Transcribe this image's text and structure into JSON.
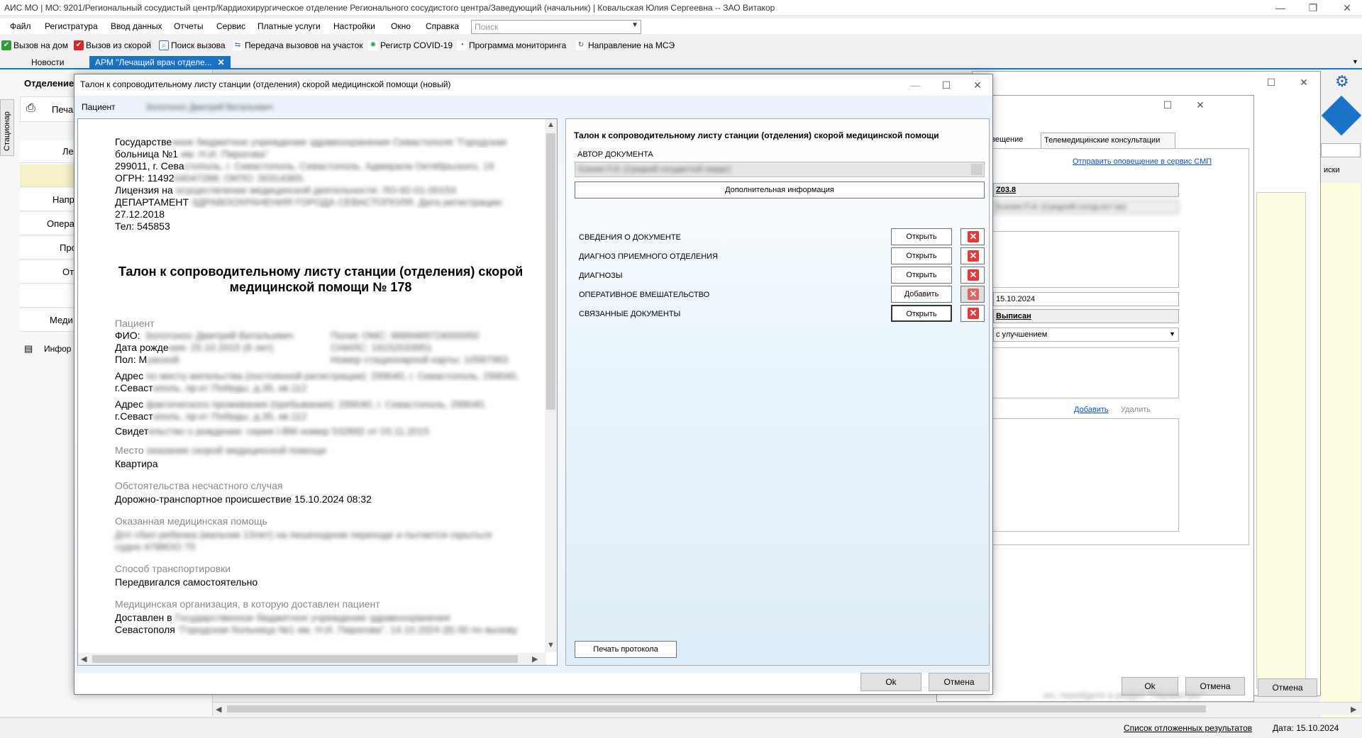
{
  "app": {
    "title": "АИС МО | МО: 9201/Региональный сосудистый центр/Кардиохирургическое отделение Регионального сосудистого центра/Заведующий (начальник) | Ковальская Юлия Сергеевна -- ЗАО Витакор"
  },
  "menu": {
    "items": [
      "Файл",
      "Регистратура",
      "Ввод данных",
      "Отчеты",
      "Сервис",
      "Платные услуги",
      "Настройки",
      "Окно",
      "Справка"
    ],
    "search_placeholder": "Поиск"
  },
  "toolbar": {
    "items": [
      {
        "label": "Вызов на дом",
        "icon": "house-call-icon",
        "color": "#2e9e3a"
      },
      {
        "label": "Вызов из скорой",
        "icon": "ambulance-call-icon",
        "color": "#d9262b"
      },
      {
        "label": "Поиск вызова",
        "icon": "search-call-icon",
        "color": "#3a6cc7"
      },
      {
        "label": "Передача вызовов на участок",
        "icon": "transfer-icon",
        "color": "#3a6cc7"
      },
      {
        "label": "Регистр COVID-19",
        "icon": "virus-icon",
        "color": "#2e9e3a"
      },
      {
        "label": "Программа мониторинга",
        "icon": "monitoring-icon",
        "color": "#444444"
      },
      {
        "label": "Направление на МСЭ",
        "icon": "referral-icon",
        "color": "#444444"
      }
    ]
  },
  "tabs": {
    "news": "Новости",
    "arm": "АРМ \"Лечащий врач отделе...",
    "close": "✕"
  },
  "left": {
    "header": "Отделение",
    "vertical_tab": "Стационар",
    "print": "Печа",
    "rows": [
      "Ле",
      "",
      "Напр",
      "Опера",
      "Про",
      "От",
      "",
      "Меди"
    ],
    "info": "Инфор"
  },
  "bg_dialog": {
    "tab_notify": "овещение",
    "tab_tele": "Телемедицинские консультации",
    "send_link": "Отправить оповещение в сервис СМП",
    "diag_code": "Z03.8",
    "doctor_blur": "Ксения П.И. (Средний сосуд.ист ор)",
    "date": "15.10.2024",
    "status": "Выписан",
    "outcome": "с улучшением",
    "add_link": "Добавить",
    "delete_link": "Удалить",
    "ok": "Ok",
    "cancel": "Отмена",
    "cancel2": "Отмена",
    "side_text": "иски",
    "watermark": "ws, перейдите в раздел \"Параметры\""
  },
  "dialog": {
    "title": "Талон к сопроводительному листу станции (отделения) скорой медицинской помощи (новый)",
    "patient_label": "Пациент",
    "patient_value": "Золотонос Дмитрий Витальевич",
    "ok": "Ok",
    "cancel": "Отмена"
  },
  "document": {
    "header_lines": [
      "Государственное бюджетное учреждение здравоохранения Севастополя \"Городская",
      "больница №1 им. Н.И. Пирогова\"",
      "299011, г. Севастополь, г. Севастополь, Севастополь, Адмирала Октябрьского, 19",
      "ОГРН: 1149204047288; ОКПО: 00314365;",
      "Лицензия на осуществление медицинской деятельности: ЛО-92-01-00153",
      "ДЕПАРТАМЕНТ ЗДРАВООХРАНЕНИЯ ГОРОДА СЕВАСТОПОЛЯ. Дата регистрации:",
      "27.12.2018",
      "Тел: 545853"
    ],
    "header_clear": [
      "Государстве",
      "больница №1",
      "299011, г. Сева",
      "ОГРН: 11492",
      "Лицензия на",
      "ДЕПАРТАМЕНТ",
      "27.12.2018",
      "Тел: 545853"
    ],
    "header_blur": [
      "нное бюджетное учреждение здравоохранения Севастополя \"Городская",
      " им. Н.И. Пирогова\"",
      "стополь, г. Севастополь, Севастополь, Адмирала Октябрьского, 19",
      "04047288; ОКПО: 00314365;",
      " осуществление медицинской деятельности: ЛО-92-01-00153",
      " ЗДРАВООХРАНЕНИЯ ГОРОДА СЕВАСТОПОЛЯ. Дата регистрации:",
      "",
      ""
    ],
    "title": "Талон к сопроводительному листу станции (отделения) скорой медицинской помощи № 178",
    "patient_section": "Пациент",
    "fio_label": "ФИО:",
    "fio_value": "Золотонос Дмитрий Витальевич",
    "policy": "Полис ОМС: 9689489724000050",
    "dob_label": "Дата рожде",
    "dob_value": "ния: 25.10.2015 (8 лет)",
    "snils": "СНИЛС: 19152033951",
    "sex_label": "Пол: М",
    "sex_value": "ужской",
    "card": "Номер стационарной карты: 10587963",
    "addr_reg_label": "Адрес",
    "addr_reg_value": " по месту жительства (постоянной регистрации): 299040, г. Севастополь, 299040,",
    "addr_reg_line2_clear": "г.Севаст",
    "addr_reg_line2_blur": "ополь, пр-кт Победы, д.35, кв.112",
    "addr_fact_label": "Адрес",
    "addr_fact_value": " фактического проживания (пребывания): 299040, г. Севастополь, 299040,",
    "addr_fact_line2_clear": "г.Севаст",
    "addr_fact_line2_blur": "ополь, пр-кт Победы, д.35, кв.112",
    "cert_clear": "Свидет",
    "cert_blur": "ельство о рождении: серия I-ВМ номер 532692 от 03.11.2015",
    "place_label_clear": "Место ",
    "place_label_blur": "оказания скорой медицинской помощи",
    "place_value": "Квартира",
    "circ_label": "Обстоятельства несчастного случая",
    "circ_value": "Дорожно-транспортное происшествие 15.10.2024 08:32",
    "help_label": "Оказанная медицинская помощь",
    "help_value": "Дтп сбил ребенка (мальчик 13лет) на пешеходном переходе и пытается скрыться",
    "help_value2": "судно 4788ОО 75",
    "transport_label": "Способ транспортировки",
    "transport_value": "Передвигался самостоятельно",
    "org_label": "Медицинская организация, в которую доставлен пациент",
    "org_clear": "Доставлен в ",
    "org_blur": "Государственное бюджетное учреждение здравоохранения",
    "org_line2_clear": "Севастополя ",
    "org_line2_blur": "\"Городская больница №1 им. Н.И. Пирогова\", 14.10.2024 (8) 00 по вызову"
  },
  "right": {
    "title": "Талон к сопроводительному листу станции (отделения) скорой медицинской помощи",
    "author_label": "АВТОР ДОКУМЕНТА",
    "author_value": "Ксения П.И. (Средний сосудистый хирург)",
    "addinfo": "Дополнительная информация",
    "sections": [
      {
        "label": "СВЕДЕНИЯ О ДОКУМЕНТЕ",
        "button": "Открыть",
        "del_disabled": false,
        "focused": false
      },
      {
        "label": "ДИАГНОЗ ПРИЕМНОГО ОТДЕЛЕНИЯ",
        "button": "Открыть",
        "del_disabled": false,
        "focused": false
      },
      {
        "label": "ДИАГНОЗЫ",
        "button": "Открыть",
        "del_disabled": false,
        "focused": false
      },
      {
        "label": "ОПЕРАТИВНОЕ ВМЕШАТЕЛЬСТВО",
        "button": "Добавить",
        "del_disabled": true,
        "focused": false
      },
      {
        "label": "СВЯЗАННЫЕ ДОКУМЕНТЫ",
        "button": "Открыть",
        "del_disabled": false,
        "focused": true
      }
    ],
    "print": "Печать протокола"
  },
  "status": {
    "deferred": "Список отложенных результатов",
    "date": "Дата: 15.10.2024"
  }
}
